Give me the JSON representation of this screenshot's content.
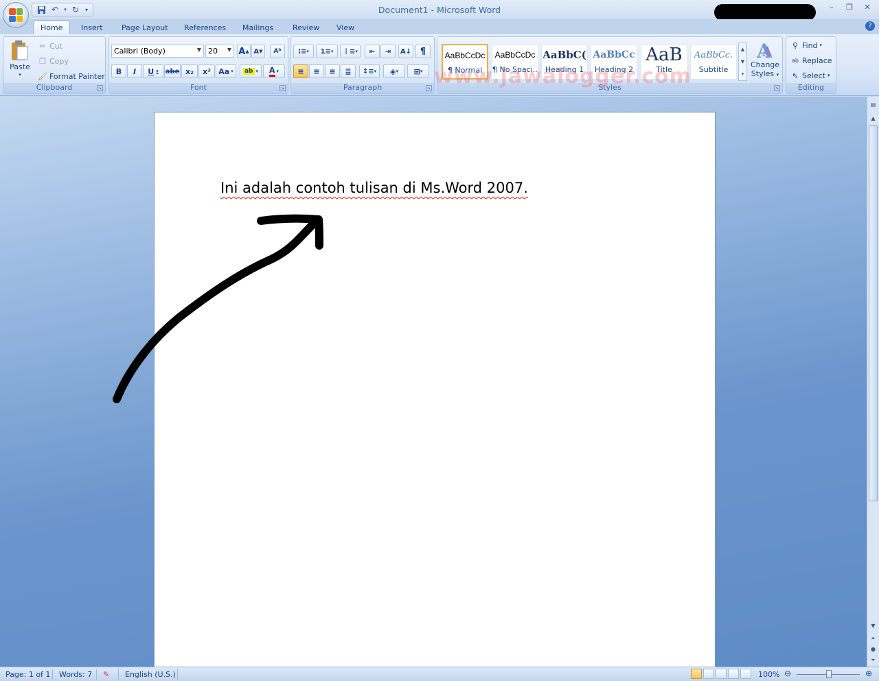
{
  "window": {
    "title": "Document1 - Microsoft Word"
  },
  "quick_access": {
    "save_icon": "save-icon",
    "undo_icon": "undo-icon",
    "redo_icon": "redo-icon"
  },
  "tabs": [
    {
      "label": "Home"
    },
    {
      "label": "Insert"
    },
    {
      "label": "Page Layout"
    },
    {
      "label": "References"
    },
    {
      "label": "Mailings"
    },
    {
      "label": "Review"
    },
    {
      "label": "View"
    }
  ],
  "clipboard": {
    "paste": "Paste",
    "cut": "Cut",
    "copy": "Copy",
    "format_painter": "Format Painter",
    "label": "Clipboard"
  },
  "font": {
    "name": "Calibri (Body)",
    "size": "20",
    "label": "Font",
    "bold": "B",
    "italic": "I",
    "underline": "U",
    "strike": "abe",
    "subscript": "x₂",
    "superscript": "x²",
    "change_case": "Aa",
    "grow": "A",
    "shrink": "A"
  },
  "paragraph": {
    "label": "Paragraph",
    "pilcrow": "¶"
  },
  "styles": {
    "label": "Styles",
    "items": [
      {
        "sample": "AaBbCcDc",
        "name": "¶ Normal"
      },
      {
        "sample": "AaBbCcDc",
        "name": "¶ No Spaci..."
      },
      {
        "sample": "AaBbC(",
        "name": "Heading 1"
      },
      {
        "sample": "AaBbCc",
        "name": "Heading 2"
      },
      {
        "sample": "AaB",
        "name": "Title"
      },
      {
        "sample": "AaBbCc.",
        "name": "Subtitle"
      }
    ],
    "change_styles": "Change",
    "change_styles_2": "Styles"
  },
  "editing": {
    "label": "Editing",
    "find": "Find",
    "replace": "Replace",
    "select": "Select"
  },
  "watermark": "www.jawalogger.com",
  "document": {
    "text": "Ini adalah contoh tulisan di Ms.Word 2007."
  },
  "status": {
    "page": "Page: 1 of 1",
    "words": "Words: 7",
    "language": "English (U.S.)",
    "zoom": "100%"
  },
  "colors": {
    "accent": "#15428b",
    "ribbon": "#dde9f8",
    "doc_bg": "#6b95cc",
    "highlight": "#f9c45e"
  }
}
